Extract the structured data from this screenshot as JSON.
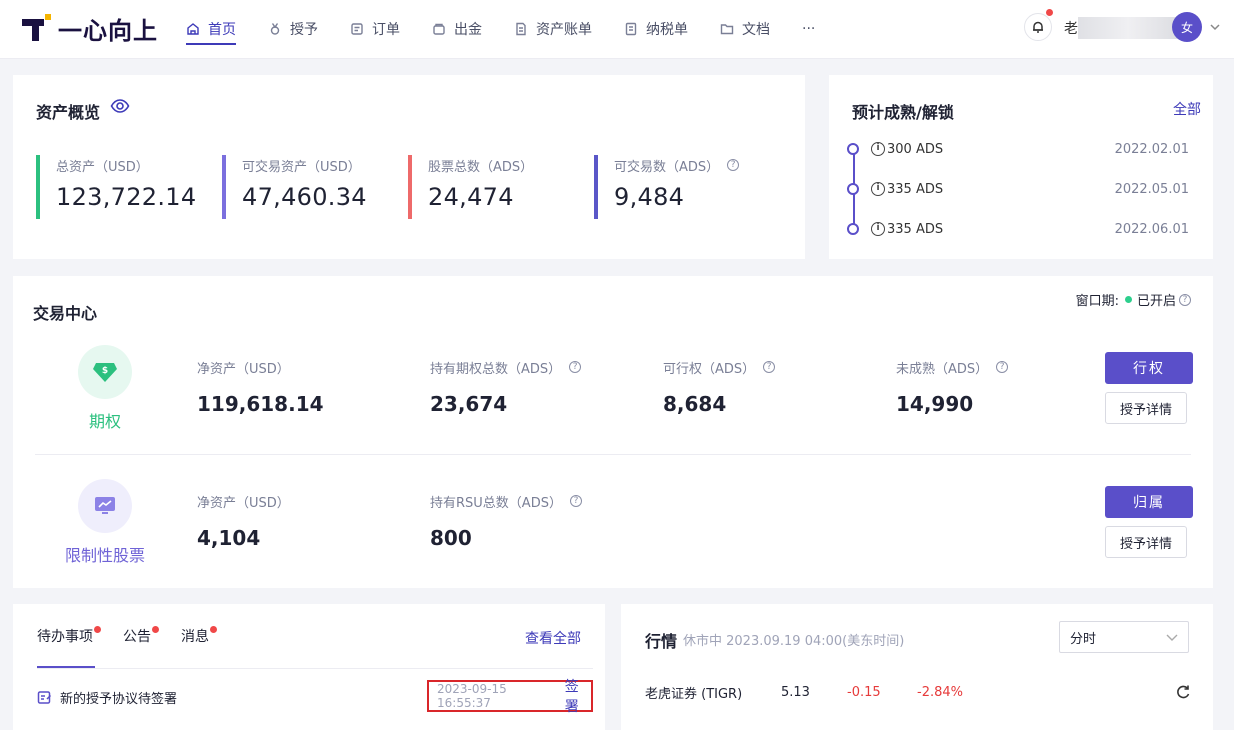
{
  "header": {
    "logo_text": "一心向上",
    "nav": [
      "首页",
      "授予",
      "订单",
      "出金",
      "资产账单",
      "纳税单",
      "文档",
      "···"
    ],
    "user_initial": "老",
    "avatar_text": "女"
  },
  "overview": {
    "title": "资产概览",
    "stats": [
      {
        "label": "总资产（USD）",
        "value": "123,722.14",
        "color": "#2cc07f"
      },
      {
        "label": "可交易资产（USD）",
        "value": "47,460.34",
        "color": "#7b6fde"
      },
      {
        "label": "股票总数（ADS）",
        "value": "24,474",
        "color": "#ee6a6a"
      },
      {
        "label": "可交易数（ADS）",
        "value": "9,484",
        "color": "#5a57c8"
      }
    ]
  },
  "unlock": {
    "title": "预计成熟/解锁",
    "all_link": "全部",
    "items": [
      {
        "amount": "300 ADS",
        "date": "2022.02.01"
      },
      {
        "amount": "335 ADS",
        "date": "2022.05.01"
      },
      {
        "amount": "335 ADS",
        "date": "2022.06.01"
      }
    ]
  },
  "trade": {
    "title": "交易中心",
    "window_label": "窗口期:",
    "window_status": "已开启",
    "option": {
      "name": "期权",
      "metrics": [
        {
          "label": "净资产（USD）",
          "value": "119,618.14"
        },
        {
          "label": "持有期权总数（ADS）",
          "value": "23,674"
        },
        {
          "label": "可行权（ADS）",
          "value": "8,684"
        },
        {
          "label": "未成熟（ADS）",
          "value": "14,990"
        }
      ],
      "primary_btn": "行权",
      "detail_btn": "授予详情"
    },
    "rsu": {
      "name": "限制性股票",
      "metrics": [
        {
          "label": "净资产（USD）",
          "value": "4,104"
        },
        {
          "label": "持有RSU总数（ADS）",
          "value": "800"
        }
      ],
      "primary_btn": "归属",
      "detail_btn": "授予详情"
    }
  },
  "todo": {
    "tabs": [
      "待办事项",
      "公告",
      "消息"
    ],
    "view_all": "查看全部",
    "item": {
      "text": "新的授予协议待签署",
      "time": "2023-09-15 16:55:37",
      "action": "签署"
    }
  },
  "market": {
    "title": "行情",
    "status": "休市中 2023.09.19 04:00(美东时间)",
    "select": "分时",
    "row": {
      "name": "老虎证券 (TIGR)",
      "price": "5.13",
      "change": "-0.15",
      "pct": "-2.84%"
    }
  }
}
